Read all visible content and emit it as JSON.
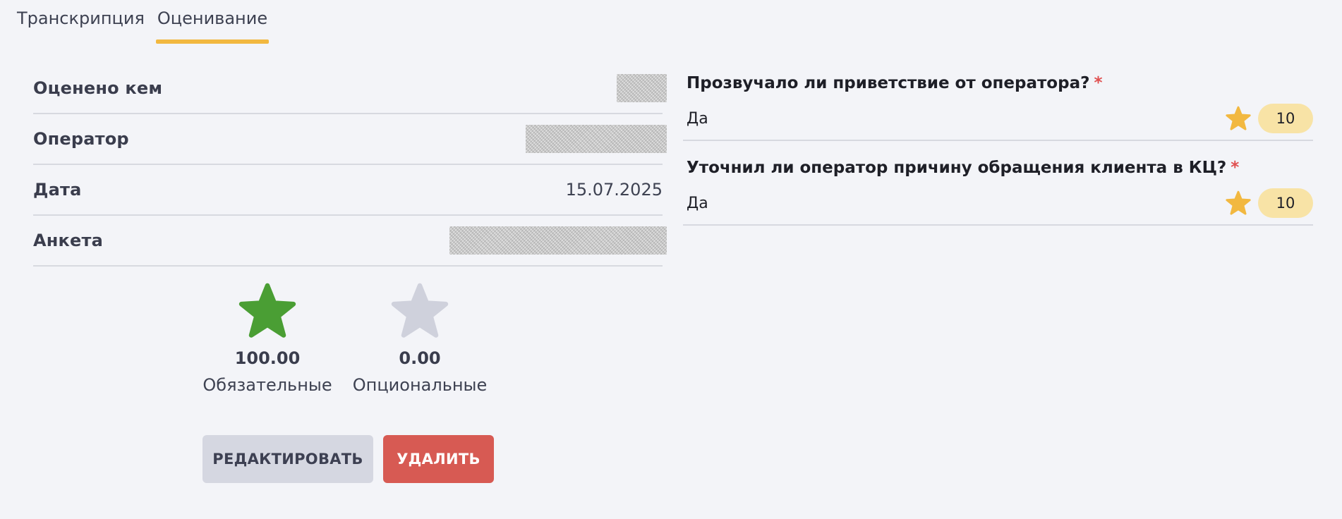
{
  "tabs": [
    {
      "label": "Транскрипция",
      "active": false
    },
    {
      "label": "Оценивание",
      "active": true
    }
  ],
  "info": {
    "rated_by_label": "Оценено кем",
    "operator_label": "Оператор",
    "date_label": "Дата",
    "date_value": "15.07.2025",
    "form_label": "Анкета"
  },
  "scores": {
    "required": {
      "value": "100.00",
      "label": "Обязательные",
      "color": "#4a9e34"
    },
    "optional": {
      "value": "0.00",
      "label": "Опциональные",
      "color": "#cfd1dc"
    }
  },
  "actions": {
    "edit_label": "РЕДАКТИРОВАТЬ",
    "delete_label": "УДАЛИТЬ"
  },
  "questions": [
    {
      "title": "Прозвучало ли приветствие от оператора?",
      "required_mark": "*",
      "answer": "Да",
      "points": "10"
    },
    {
      "title": "Уточнил ли оператор причину обращения клиента в КЦ?",
      "required_mark": "*",
      "answer": "Да",
      "points": "10"
    }
  ],
  "colors": {
    "accent": "#f2b840",
    "delete": "#d75a53",
    "star_gold": "#f2b840"
  }
}
